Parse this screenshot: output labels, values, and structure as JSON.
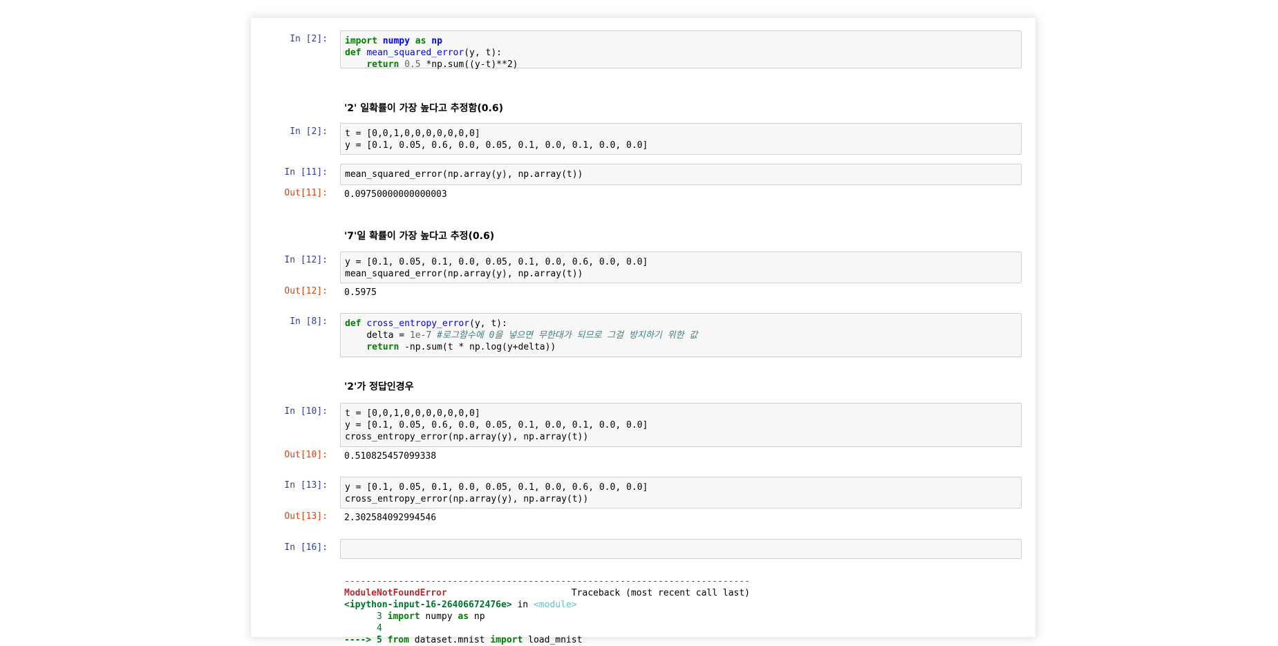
{
  "cells": {
    "c1": {
      "prompt": "In [2]:"
    },
    "md1": {
      "text": "'2' 일확률이 가장 높다고 추정함(0.6)"
    },
    "c2": {
      "prompt": "In [2]:",
      "line1": "t = [0,0,1,0,0,0,0,0,0,0]",
      "line2": "y = [0.1, 0.05, 0.6, 0.0, 0.05, 0.1, 0.0, 0.1, 0.0, 0.0]"
    },
    "c3": {
      "prompt": "In [11]:",
      "line1": "mean_squared_error(np.array(y), np.array(t))",
      "out_prompt": "Out[11]:",
      "output": "0.09750000000000003"
    },
    "md2": {
      "text": "'7'일 확률이 가장 높다고 추정(0.6)"
    },
    "c4": {
      "prompt": "In [12]:",
      "line1": "y = [0.1, 0.05, 0.1, 0.0, 0.05, 0.1, 0.0, 0.6, 0.0, 0.0]",
      "line2": "mean_squared_error(np.array(y), np.array(t))",
      "out_prompt": "Out[12]:",
      "output": "0.5975"
    },
    "c5": {
      "prompt": "In [8]:"
    },
    "md3": {
      "text": "'2'가 정답인경우"
    },
    "c6": {
      "prompt": "In [10]:",
      "line1": "t = [0,0,1,0,0,0,0,0,0,0]",
      "line2": "y = [0.1, 0.05, 0.6, 0.0, 0.05, 0.1, 0.0, 0.1, 0.0, 0.0]",
      "line3": "cross_entropy_error(np.array(y), np.array(t))",
      "out_prompt": "Out[10]:",
      "output": "0.510825457099338"
    },
    "c7": {
      "prompt": "In [13]:",
      "line1": "y = [0.1, 0.05, 0.1, 0.0, 0.05, 0.1, 0.0, 0.6, 0.0, 0.0]",
      "line2": "cross_entropy_error(np.array(y), np.array(t))",
      "out_prompt": "Out[13]:",
      "output": "2.302584092994546"
    },
    "c8": {
      "prompt": "In [16]:"
    }
  },
  "code1": {
    "kw_import": "import",
    "mod_numpy": "numpy",
    "kw_as": "as",
    "alias_np": "np",
    "kw_def": "def",
    "fn_name": "mean_squared_error",
    "fn_args": "(y, t):",
    "indent": "    ",
    "kw_return": "return",
    "num_half": "0.5",
    "ret_rest": " *np.sum((y-t)**2)"
  },
  "code5": {
    "kw_def": "def",
    "fn_name": "cross_entropy_error",
    "fn_args": "(y, t):",
    "indent": "    ",
    "delta_assign": "delta = ",
    "num_delta": "1e-7",
    "comment": "#로그함수에 0을 넣으면 무한대가 되므로 그걸 방지하기 위한 값",
    "kw_return": "return",
    "ret_rest": " -np.sum(t * np.log(y+delta))"
  },
  "traceback": {
    "dashes": "---------------------------------------------------------------------------",
    "error_name": "ModuleNotFoundError",
    "header_rest": "                       Traceback (most recent call last)",
    "input_ref": "<ipython-input-16-26406672476e>",
    "in_text": " in ",
    "module_ref": "<module>",
    "line3_no": "      3 ",
    "line3_kw1": "import",
    "line3_mid": " numpy ",
    "line3_kw2": "as",
    "line3_end": " np",
    "line4_no": "      4",
    "arrow": "----> 5 ",
    "line5_kw1": "from",
    "line5_mid": " dataset.mnist ",
    "line5_kw2": "import",
    "line5_end": " load_mnist"
  }
}
